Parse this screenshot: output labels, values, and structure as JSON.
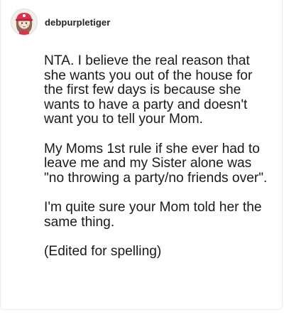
{
  "post": {
    "author": {
      "username": "debpurpletiger",
      "avatar_icon": "cartoon-girl-avatar-icon"
    },
    "paragraphs": [
      "NTA. I believe the real reason that she wants you out of the house for the first few days is because she wants to have a party and doesn't want you to tell your Mom.",
      "My Moms 1st rule if she ever had to leave me and my Sister alone was \"no throwing a party/no friends over\".",
      "I'm quite sure your Mom told her the same thing.",
      "(Edited for spelling)"
    ]
  },
  "colors": {
    "background": "#ffffff",
    "text": "#1a1a1a",
    "avatar_accent": "#d9334f",
    "card_border": "#ececec"
  }
}
